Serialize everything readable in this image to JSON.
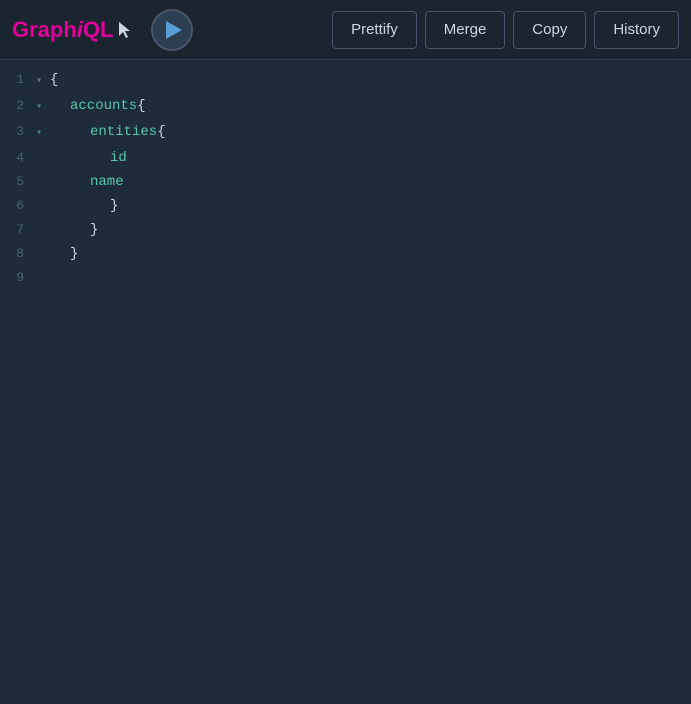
{
  "app": {
    "name": "GraphiQL",
    "name_graph": "Graph",
    "name_i": "i",
    "name_ql": "QL"
  },
  "toolbar": {
    "prettify_label": "Prettify",
    "merge_label": "Merge",
    "copy_label": "Copy",
    "history_label": "History"
  },
  "editor": {
    "lines": [
      {
        "number": "1",
        "fold": "▾",
        "indent": 0,
        "tokens": [
          {
            "text": "{",
            "class": "kw-brace"
          }
        ]
      },
      {
        "number": "2",
        "fold": "▾",
        "indent": 1,
        "tokens": [
          {
            "text": "accounts",
            "class": "kw-field"
          },
          {
            "text": " {",
            "class": "kw-brace"
          }
        ]
      },
      {
        "number": "3",
        "fold": "▾",
        "indent": 2,
        "tokens": [
          {
            "text": "entities",
            "class": "kw-field"
          },
          {
            "text": " {",
            "class": "kw-brace"
          }
        ]
      },
      {
        "number": "4",
        "fold": "",
        "indent": 3,
        "tokens": [
          {
            "text": "id",
            "class": "kw-field"
          }
        ]
      },
      {
        "number": "5",
        "fold": "",
        "indent": 2,
        "tokens": [
          {
            "text": "name",
            "class": "kw-field"
          }
        ]
      },
      {
        "number": "6",
        "fold": "",
        "indent": 3,
        "tokens": [
          {
            "text": "}",
            "class": "kw-brace"
          }
        ]
      },
      {
        "number": "7",
        "fold": "",
        "indent": 2,
        "tokens": [
          {
            "text": "}",
            "class": "kw-brace"
          }
        ]
      },
      {
        "number": "8",
        "fold": "",
        "indent": 1,
        "tokens": [
          {
            "text": "}",
            "class": "kw-brace"
          }
        ]
      },
      {
        "number": "9",
        "fold": "",
        "indent": 0,
        "tokens": []
      }
    ]
  }
}
